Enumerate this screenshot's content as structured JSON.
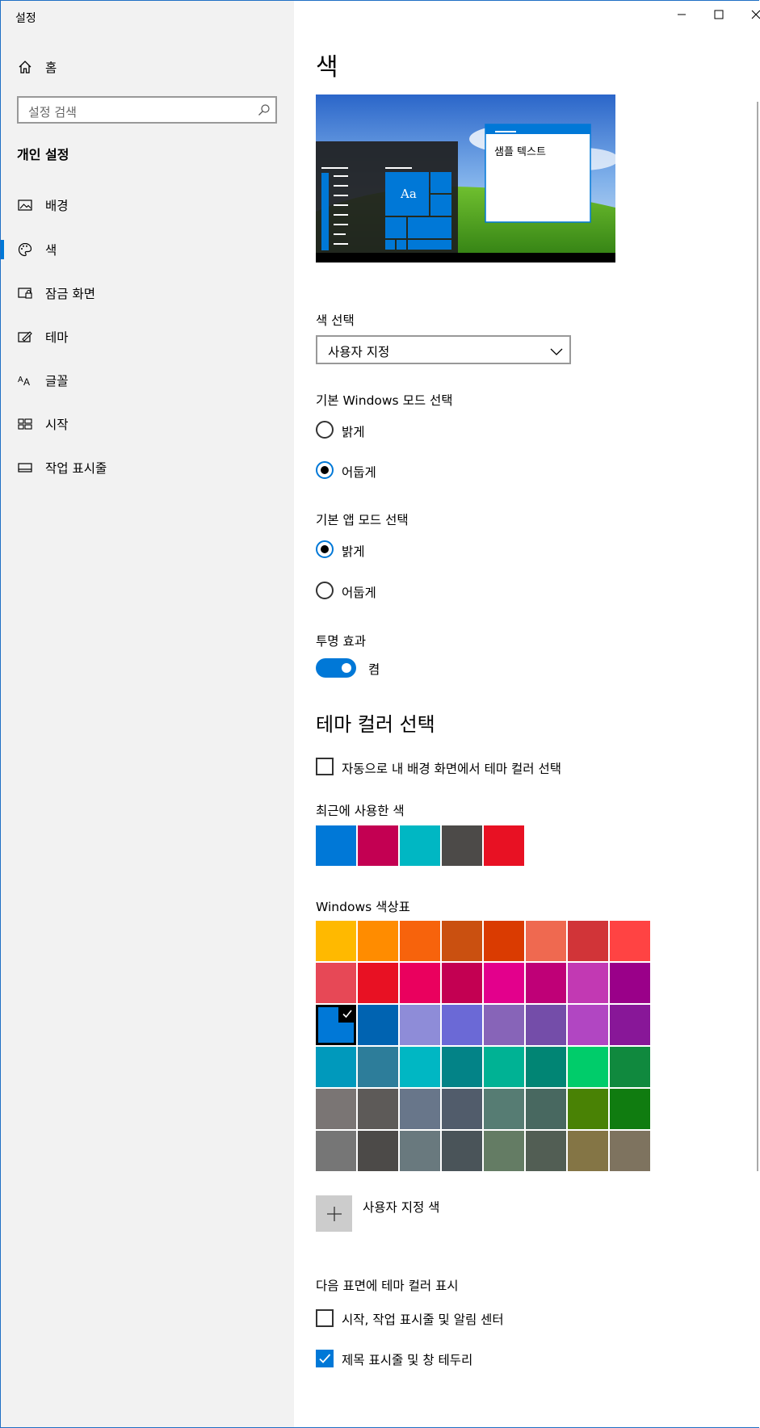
{
  "window": {
    "title": "설정"
  },
  "sidebar": {
    "home": "홈",
    "search_placeholder": "설정 검색",
    "section": "개인 설정",
    "items": [
      {
        "label": "배경",
        "icon": "image-icon"
      },
      {
        "label": "색",
        "icon": "palette-icon"
      },
      {
        "label": "잠금 화면",
        "icon": "lock-screen-icon"
      },
      {
        "label": "테마",
        "icon": "theme-icon"
      },
      {
        "label": "글꼴",
        "icon": "font-icon"
      },
      {
        "label": "시작",
        "icon": "start-icon"
      },
      {
        "label": "작업 표시줄",
        "icon": "taskbar-icon"
      }
    ],
    "selected": "색"
  },
  "main": {
    "title": "색",
    "preview": {
      "sample_text": "샘플 텍스트",
      "tile_text": "Aa"
    },
    "color_choice": {
      "label": "색 선택",
      "value": "사용자 지정"
    },
    "windows_mode": {
      "label": "기본 Windows 모드 선택",
      "options": [
        "밝게",
        "어둡게"
      ],
      "selected": "어둡게"
    },
    "app_mode": {
      "label": "기본 앱 모드 선택",
      "options": [
        "밝게",
        "어둡게"
      ],
      "selected": "밝게"
    },
    "transparency": {
      "label": "투명 효과",
      "state": "켬",
      "on": true
    },
    "accent_heading": "테마 컬러 선택",
    "auto_pick": {
      "label": "자동으로 내 배경 화면에서 테마 컬러 선택",
      "checked": false
    },
    "recent": {
      "label": "최근에 사용한 색",
      "colors": [
        "#0078d7",
        "#c30052",
        "#00b7c3",
        "#4c4a48",
        "#e81123"
      ]
    },
    "palette": {
      "label": "Windows 색상표",
      "rows": [
        [
          "#ffb900",
          "#ff8c00",
          "#f7630c",
          "#ca5010",
          "#da3b01",
          "#ef6950",
          "#d13438",
          "#ff4343"
        ],
        [
          "#e74856",
          "#e81123",
          "#ea005e",
          "#c30052",
          "#e3008c",
          "#bf0077",
          "#c239b3",
          "#9a0089"
        ],
        [
          "#0078d7",
          "#0063b1",
          "#8e8cd8",
          "#6b69d6",
          "#8764b8",
          "#744da9",
          "#b146c2",
          "#881798"
        ],
        [
          "#0099bc",
          "#2d7d9a",
          "#00b7c3",
          "#038387",
          "#00b294",
          "#018574",
          "#00cc6a",
          "#10893e"
        ],
        [
          "#7a7574",
          "#5d5a58",
          "#68768a",
          "#515c6b",
          "#567c73",
          "#486860",
          "#498205",
          "#107c10"
        ],
        [
          "#767676",
          "#4c4a48",
          "#69797e",
          "#4a5459",
          "#647c64",
          "#525e54",
          "#847545",
          "#7e735f"
        ]
      ],
      "selected_color": "#0078d7"
    },
    "custom_color": "사용자 지정 색",
    "surfaces": {
      "label": "다음 표면에 테마 컬러 표시",
      "start": {
        "label": "시작, 작업 표시줄 및 알림 센터",
        "checked": false
      },
      "title_bars": {
        "label": "제목 표시줄 및 창 테두리",
        "checked": true
      }
    }
  }
}
